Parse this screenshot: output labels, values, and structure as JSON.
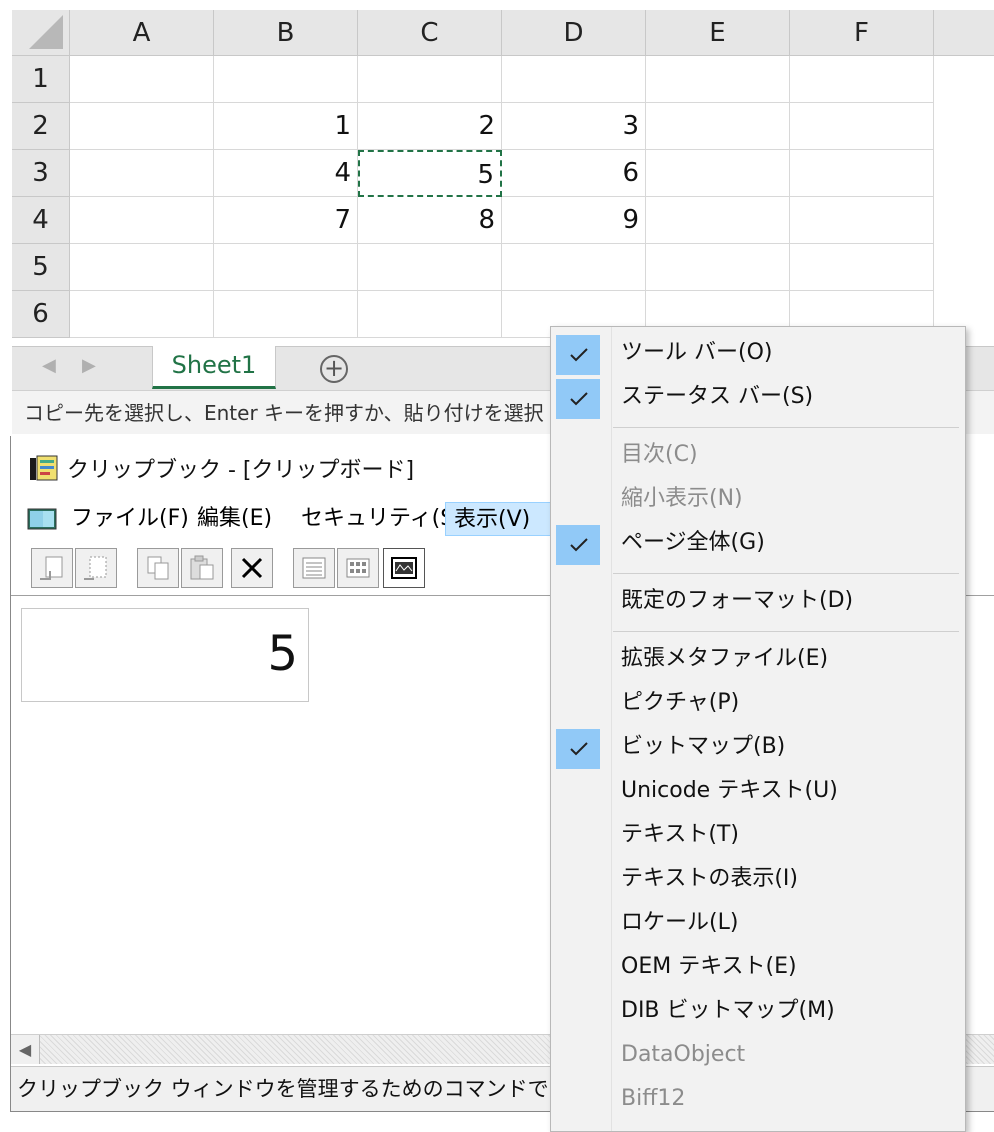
{
  "excel": {
    "columns": [
      "A",
      "B",
      "C",
      "D",
      "E",
      "F"
    ],
    "rows": [
      "1",
      "2",
      "3",
      "4",
      "5",
      "6"
    ],
    "cells": [
      [
        "",
        "",
        "",
        "",
        "",
        ""
      ],
      [
        "",
        "1",
        "2",
        "3",
        "",
        ""
      ],
      [
        "",
        "4",
        "5",
        "6",
        "",
        ""
      ],
      [
        "",
        "7",
        "8",
        "9",
        "",
        ""
      ],
      [
        "",
        "",
        "",
        "",
        "",
        ""
      ],
      [
        "",
        "",
        "",
        "",
        "",
        ""
      ]
    ],
    "sheet_tab": "Sheet1",
    "add_sheet_symbol": "+",
    "status_text": "コピー先を選択し、Enter キーを押すか、貼り付けを選択"
  },
  "clipbook": {
    "title": "クリップブック - [クリップボード]",
    "menus": [
      "ファイル(F)",
      "編集(E)",
      "セキュリティ(S)",
      "表示(V)"
    ],
    "toolbar_icons": [
      "connect-icon",
      "disconnect-icon",
      "copy-icon",
      "paste-icon",
      "delete-icon",
      "table-of-contents-icon",
      "thumbnails-icon",
      "full-page-icon"
    ],
    "preview_value": "5",
    "status_text": "クリップブック ウィンドウを管理するためのコマンドです。"
  },
  "view_menu": {
    "items": [
      {
        "label": "ツール バー(O)",
        "checked": true,
        "disabled": false
      },
      {
        "label": "ステータス バー(S)",
        "checked": true,
        "disabled": false
      },
      {
        "label": "目次(C)",
        "checked": false,
        "disabled": true
      },
      {
        "label": "縮小表示(N)",
        "checked": false,
        "disabled": true
      },
      {
        "label": "ページ全体(G)",
        "checked": true,
        "disabled": false
      },
      {
        "label": "既定のフォーマット(D)",
        "checked": false,
        "disabled": false
      },
      {
        "label": "拡張メタファイル(E)",
        "checked": false,
        "disabled": false
      },
      {
        "label": "ピクチャ(P)",
        "checked": false,
        "disabled": false
      },
      {
        "label": "ビットマップ(B)",
        "checked": true,
        "disabled": false
      },
      {
        "label": "Unicode テキスト(U)",
        "checked": false,
        "disabled": false
      },
      {
        "label": "テキスト(T)",
        "checked": false,
        "disabled": false
      },
      {
        "label": "テキストの表示(I)",
        "checked": false,
        "disabled": false
      },
      {
        "label": "ロケール(L)",
        "checked": false,
        "disabled": false
      },
      {
        "label": "OEM テキスト(E)",
        "checked": false,
        "disabled": false
      },
      {
        "label": "DIB ビットマップ(M)",
        "checked": false,
        "disabled": false
      },
      {
        "label": "DataObject",
        "checked": false,
        "disabled": true
      },
      {
        "label": "Biff12",
        "checked": false,
        "disabled": true
      }
    ]
  },
  "colors": {
    "excel_green": "#217346",
    "menu_check_bg": "#91c9f7",
    "menu_highlight": "#cce8ff"
  }
}
